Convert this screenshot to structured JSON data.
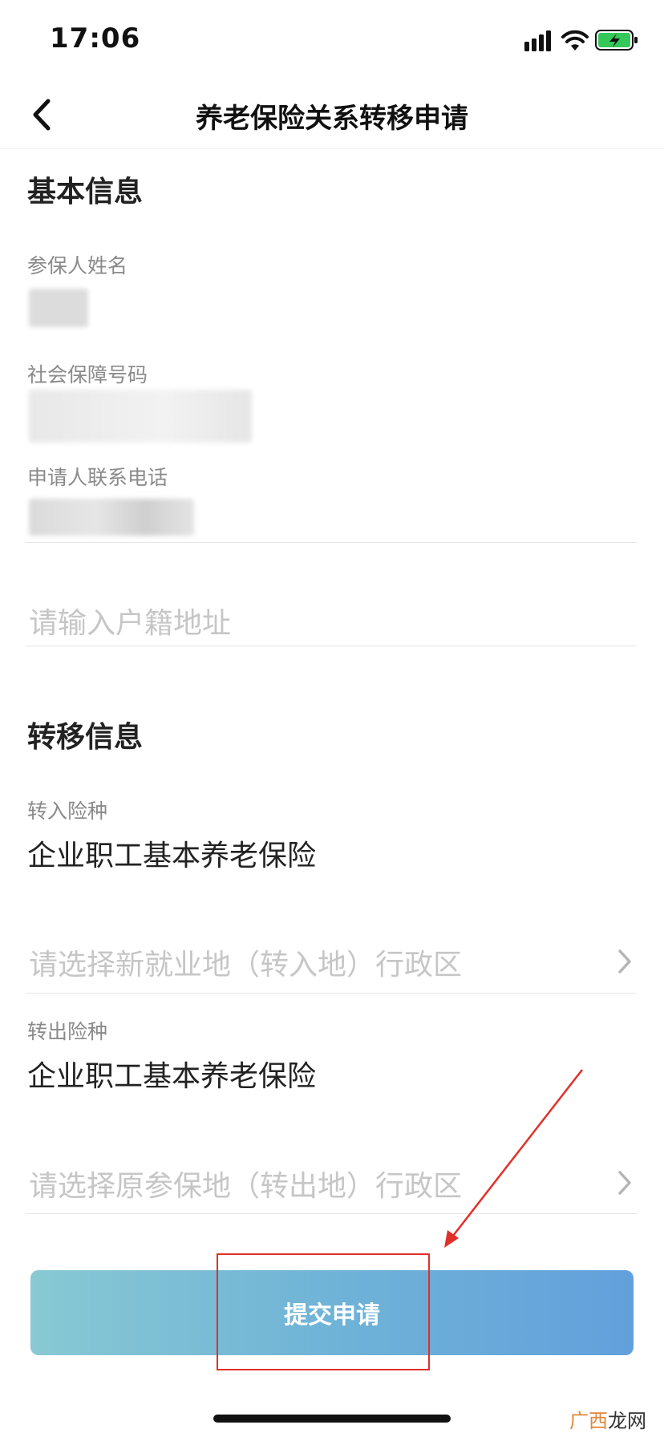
{
  "status_bar": {
    "time": "17:06",
    "signal_icon": "cellular-signal-icon",
    "wifi_icon": "wifi-icon",
    "battery_icon": "battery-charging-icon"
  },
  "nav": {
    "back_icon": "back-arrow-icon",
    "title": "养老保险关系转移申请"
  },
  "basic_info": {
    "title": "基本信息",
    "insured_name_label": "参保人姓名",
    "social_security_label": "社会保障号码",
    "phone_label": "申请人联系电话",
    "address_placeholder": "请输入户籍地址"
  },
  "transfer_info": {
    "title": "转移信息",
    "transfer_in_label": "转入险种",
    "transfer_in_value": "企业职工基本养老保险",
    "transfer_in_region_placeholder": "请选择新就业地（转入地）行政区",
    "transfer_out_label": "转出险种",
    "transfer_out_value": "企业职工基本养老保险",
    "transfer_out_region_placeholder": "请选择原参保地（转出地）行政区"
  },
  "submit": {
    "label": "提交申请"
  },
  "watermark": {
    "part1": "广西",
    "part2": "龙网"
  },
  "colors": {
    "button_gradient_start": "#88c9d3",
    "button_gradient_end": "#62a0dc",
    "annotation_red": "#e0302a",
    "placeholder": "#c6c6c6"
  }
}
